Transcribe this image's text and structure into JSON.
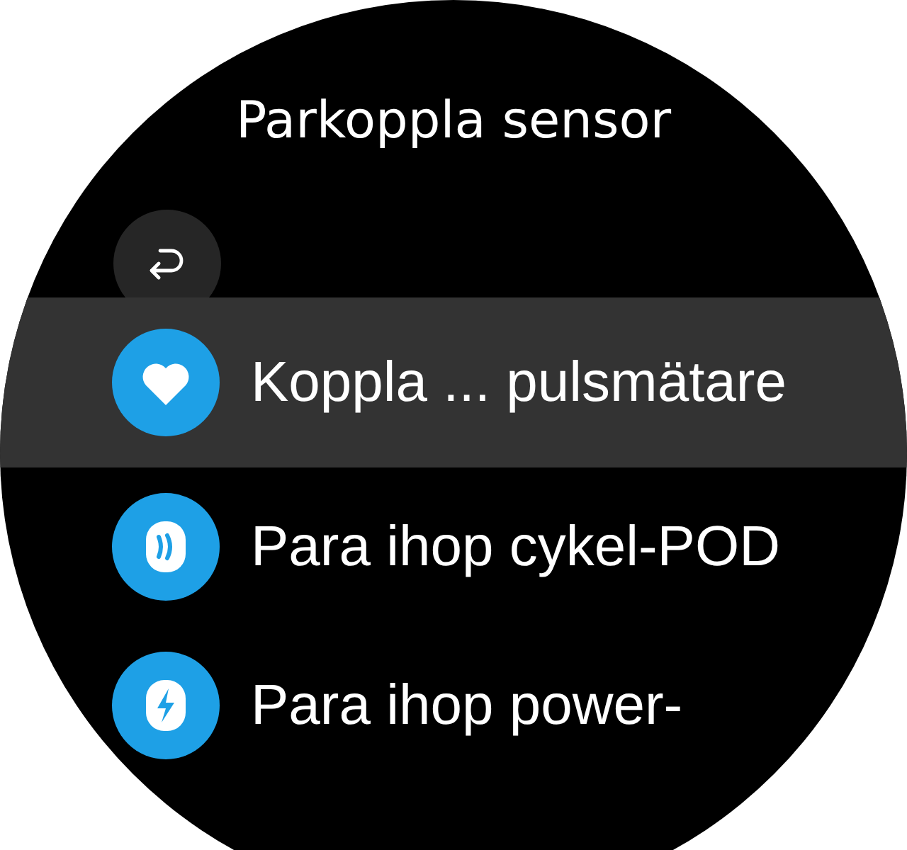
{
  "title": "Parkoppla sensor",
  "items": [
    {
      "label": "Koppla ... pulsmätare",
      "kind": "heart",
      "selected": true
    },
    {
      "label": "Para ihop cykel-POD",
      "kind": "pod",
      "selected": false
    },
    {
      "label": "Para ihop power-",
      "kind": "power",
      "selected": false
    }
  ]
}
